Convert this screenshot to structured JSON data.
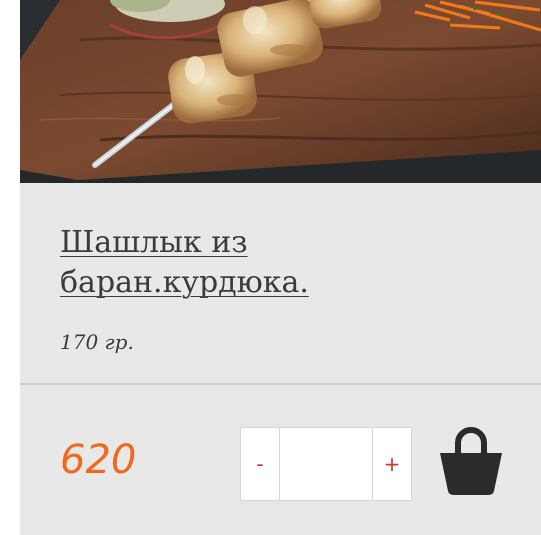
{
  "product": {
    "name": "Шашлык из баран.курдюка.",
    "weight": "170 гр.",
    "price": "620"
  },
  "quantity": {
    "minus_label": "-",
    "plus_label": "+",
    "value": ""
  },
  "icons": {
    "cart": "shopping-basket-icon"
  },
  "colors": {
    "card_background": "#e8e8e8",
    "price": "#ef6a1f",
    "stepper_symbols": "#c8352b",
    "text": "#3a3a3a",
    "cart_icon": "#2b2b2b"
  }
}
